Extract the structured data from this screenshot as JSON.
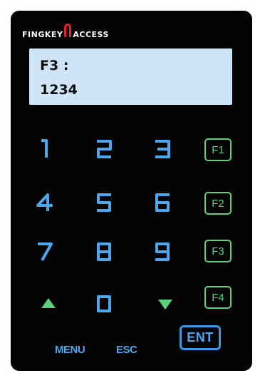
{
  "brand": {
    "left_text": "FINGKEY",
    "right_text": "ACCESS",
    "logo_icon": "fingerprint-arch-icon",
    "logo_color": "#ffffff",
    "accent_color": "#e8242a"
  },
  "display": {
    "line1": "F3 :",
    "line2": "1234",
    "background_color": "#cfe4f7"
  },
  "keypad": {
    "digit_color": "#4ba8ef",
    "function_color": "#5cd17d",
    "keys": {
      "k1": "1",
      "k2": "2",
      "k3": "3",
      "k4": "4",
      "k5": "5",
      "k6": "6",
      "k7": "7",
      "k8": "8",
      "k9": "9",
      "k0": "0"
    },
    "function_keys": [
      "F1",
      "F2",
      "F3",
      "F4"
    ],
    "up_icon": "triangle-up-icon",
    "down_icon": "triangle-down-icon"
  },
  "bottom": {
    "menu_label": "MENU",
    "esc_label": "ESC",
    "ent_label": "ENT"
  }
}
